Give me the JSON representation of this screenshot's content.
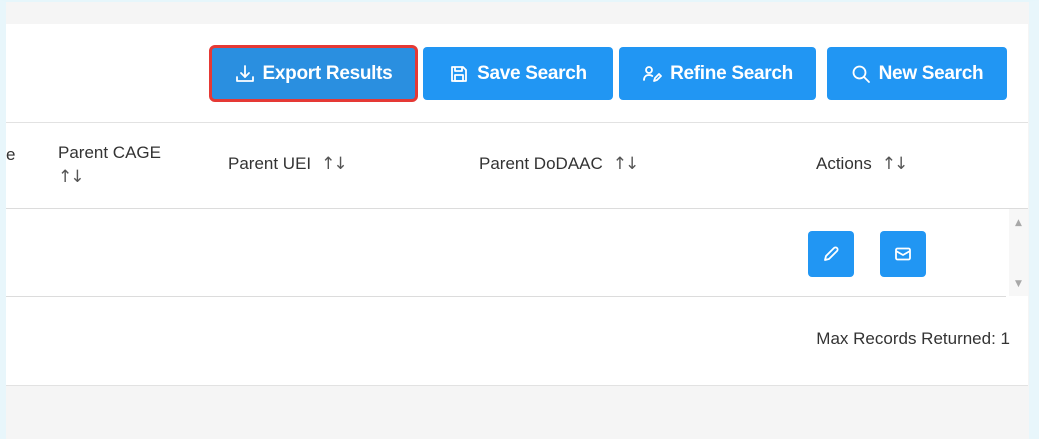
{
  "toolbar": {
    "export_label": "Export Results",
    "save_label": "Save Search",
    "refine_label": "Refine Search",
    "new_label": "New Search"
  },
  "table": {
    "columns": [
      {
        "label": "e"
      },
      {
        "label": "Parent CAGE",
        "sort": "↑↓"
      },
      {
        "label": "Parent UEI",
        "sort": "↑↓"
      },
      {
        "label": "Parent DoDAAC",
        "sort": "↑↓"
      },
      {
        "label": "Actions",
        "sort": "↑↓"
      }
    ]
  },
  "footer": {
    "max_records": "Max Records Returned: 1"
  },
  "icons": {
    "export": "download-icon",
    "save": "floppy-disk-icon",
    "refine": "user-edit-icon",
    "new": "search-icon",
    "edit": "pencil-icon",
    "mail": "envelope-icon"
  },
  "colors": {
    "primary": "#2196f3",
    "highlight_border": "#e53935",
    "frame": "#e8f6fb"
  }
}
